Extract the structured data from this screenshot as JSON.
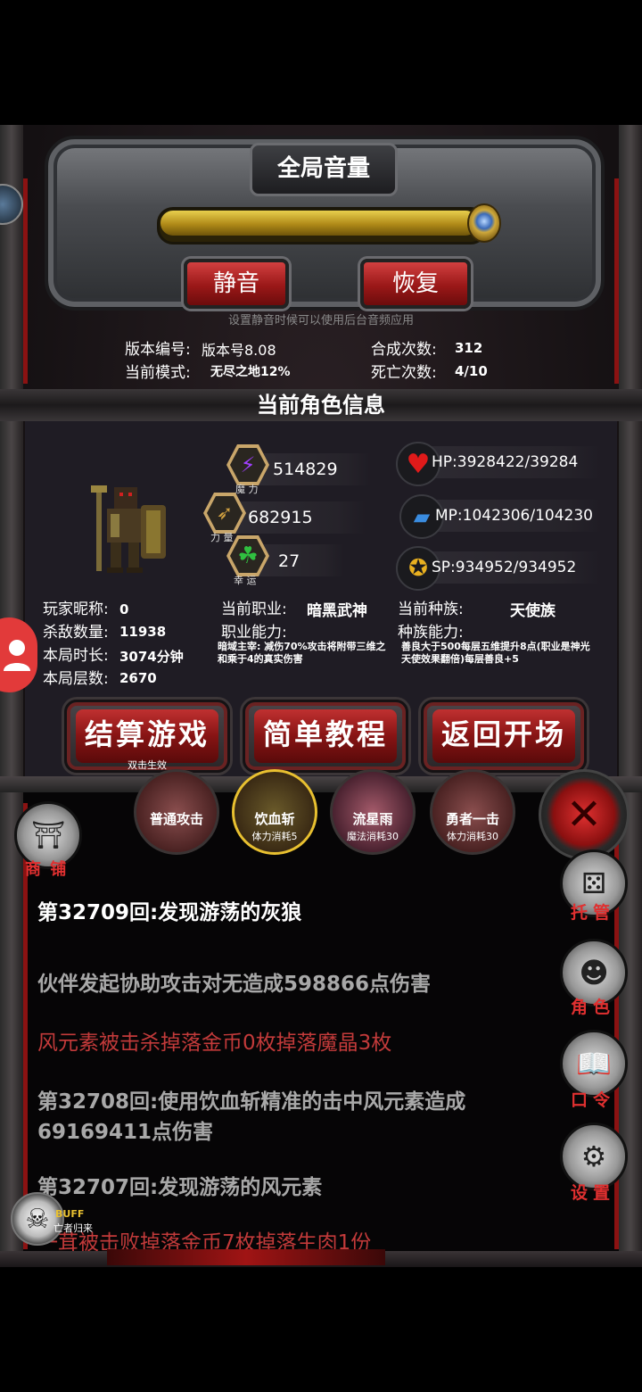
{
  "volume_panel": {
    "title": "全局音量",
    "volume_level": 1.0,
    "mute_label": "静音",
    "restore_label": "恢复",
    "hint": "设置静音时候可以使用后台音频应用"
  },
  "game_info": {
    "version_label": "版本编号:",
    "version_value": "版本号8.08",
    "mode_label": "当前模式:",
    "mode_value": "无尽之地12%",
    "synth_label": "合成次数:",
    "synth_value": "312",
    "death_label": "死亡次数:",
    "death_value": "4/10"
  },
  "character": {
    "section_title": "当前角色信息",
    "magic_value": "514829",
    "magic_label": "魔 力",
    "power_value": "682915",
    "power_label": "力 量",
    "luck_value": "27",
    "luck_label": "幸 运",
    "hp": "HP:3928422/39284",
    "mp": "MP:1042306/104230",
    "sp": "SP:934952/934952",
    "nickname_label": "玩家昵称:",
    "nickname_value": "0",
    "kills_label": "杀敌数量:",
    "kills_value": "11938",
    "duration_label": "本局时长:",
    "duration_value": "3074分钟",
    "floors_label": "本局层数:",
    "floors_value": "2670",
    "class_label": "当前职业:",
    "class_value": "暗黑武神",
    "class_ability_label": "职业能力:",
    "class_ability_desc": "暗域主宰: 减伤70%攻击将附带三维之和乘于4的真实伤害",
    "race_label": "当前种族:",
    "race_value": "天使族",
    "race_ability_label": "种族能力:",
    "race_ability_desc": "善良大于500每层五维提升8点(职业是神光天使效果翻倍)每层善良+5"
  },
  "actions": {
    "settle_label": "结算游戏",
    "settle_sub": "双击生效",
    "tutorial_label": "简单教程",
    "return_label": "返回开场"
  },
  "skills": [
    {
      "name": "普通攻击",
      "cost": ""
    },
    {
      "name": "饮血斩",
      "cost": "体力消耗5"
    },
    {
      "name": "流星雨",
      "cost": "魔法消耗30"
    },
    {
      "name": "勇者一击",
      "cost": "体力消耗30"
    }
  ],
  "shop_label": "商 铺",
  "side_menu": {
    "auto_label": "托管",
    "role_label": "角色",
    "code_label": "口令",
    "settings_label": "设置"
  },
  "buff": {
    "label": "BUFF",
    "name": "亡者归来"
  },
  "log": [
    {
      "text": "第32709回:发现游荡的灰狼",
      "color": "#ffffff"
    },
    {
      "text": "伙伴发起协助攻击对无造成598866点伤害",
      "color": "#a8a8a8"
    },
    {
      "text": "风元素被击杀掉落金币0枚掉落魔晶3枚",
      "color": "#c23a3a"
    },
    {
      "text": "第32708回:使用饮血斩精准的击中风元素造成69169411点伤害",
      "color": "#a8a8a8"
    },
    {
      "text": "第32707回:发现游荡的风元素",
      "color": "#a8a8a8"
    },
    {
      "text": "一茸被击败掉落金币7枚掉落生肉1份",
      "color": "#c23a3a"
    }
  ],
  "colors": {
    "accent_red": "#b01c1c",
    "volume_gold": "#d4b030"
  }
}
